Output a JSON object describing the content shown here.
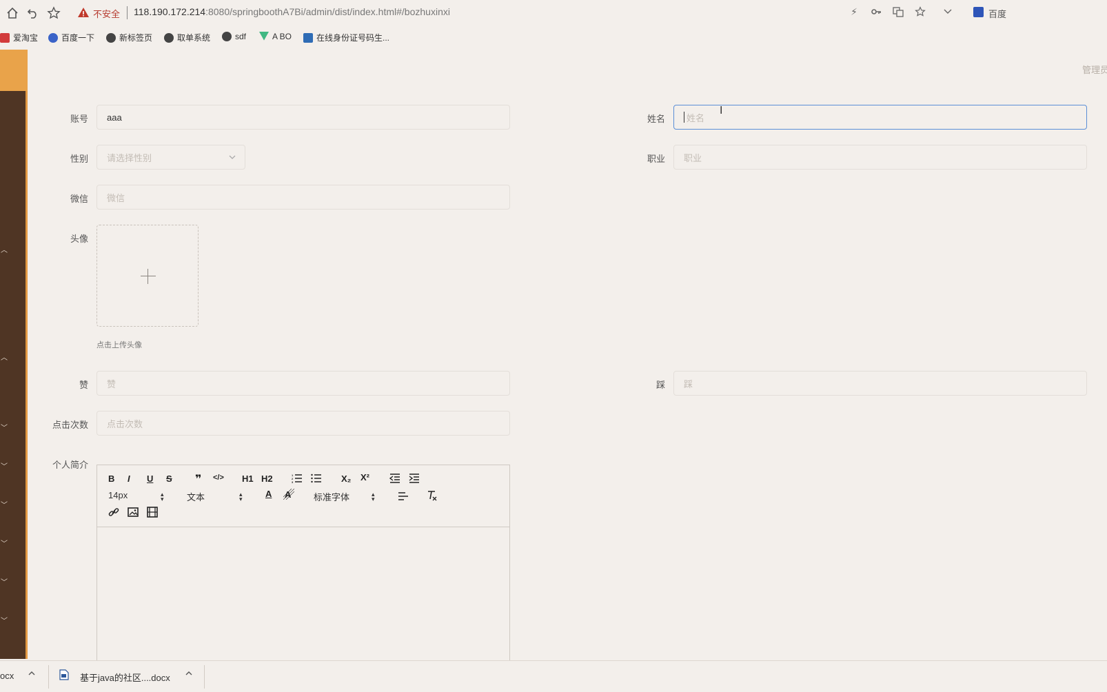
{
  "browser": {
    "insecure_label": "不安全",
    "url_host": "118.190.172.214",
    "url_rest": ":8080/springboothA7Bi/admin/dist/index.html#/bozhuxinxi",
    "search_engine": "百度",
    "nav_icons": [
      "home-icon",
      "back-icon",
      "star-icon"
    ],
    "right_icons": [
      "lightning-icon",
      "key-icon",
      "translate-icon",
      "star-icon",
      "chevron-down-icon"
    ]
  },
  "bookmarks": [
    {
      "label": "爱淘宝",
      "icon": "taobao-icon"
    },
    {
      "label": "百度一下",
      "icon": "baidu-icon"
    },
    {
      "label": "新标签页",
      "icon": "globe-icon"
    },
    {
      "label": "取单系统",
      "icon": "globe-icon"
    },
    {
      "label": "sdf",
      "icon": "globe-icon"
    },
    {
      "label": "A BO",
      "icon": "vue-icon"
    },
    {
      "label": "在线身份证号码生...",
      "icon": "search-icon"
    }
  ],
  "header": {
    "admin_label": "管理员"
  },
  "form": {
    "account": {
      "label": "账号",
      "value": "aaa"
    },
    "name": {
      "label": "姓名",
      "placeholder": "姓名"
    },
    "gender": {
      "label": "性别",
      "placeholder": "请选择性别"
    },
    "job": {
      "label": "职业",
      "placeholder": "职业"
    },
    "wechat": {
      "label": "微信",
      "placeholder": "微信"
    },
    "avatar": {
      "label": "头像",
      "tip": "点击上传头像"
    },
    "like": {
      "label": "赞",
      "placeholder": "赞"
    },
    "dislike": {
      "label": "踩",
      "placeholder": "踩"
    },
    "clicks": {
      "label": "点击次数",
      "placeholder": "点击次数"
    },
    "intro": {
      "label": "个人简介"
    }
  },
  "editor": {
    "tools_row1": [
      "B",
      "I",
      "U",
      "S",
      "❞",
      "</>",
      "H1",
      "H2",
      "ordered-list",
      "bullet-list",
      "X₂",
      "X²",
      "outdent",
      "indent"
    ],
    "size_select": "14px",
    "header_select": "文本",
    "font_select": "标准字体"
  },
  "downloads": [
    {
      "label": "ocx"
    },
    {
      "label": "基于java的社区....docx"
    }
  ],
  "colors": {
    "sidebar": "#4f3524",
    "sidebar_accent": "#e9a34a",
    "background": "#f3efeb",
    "focus_border": "#5a8ed6"
  }
}
